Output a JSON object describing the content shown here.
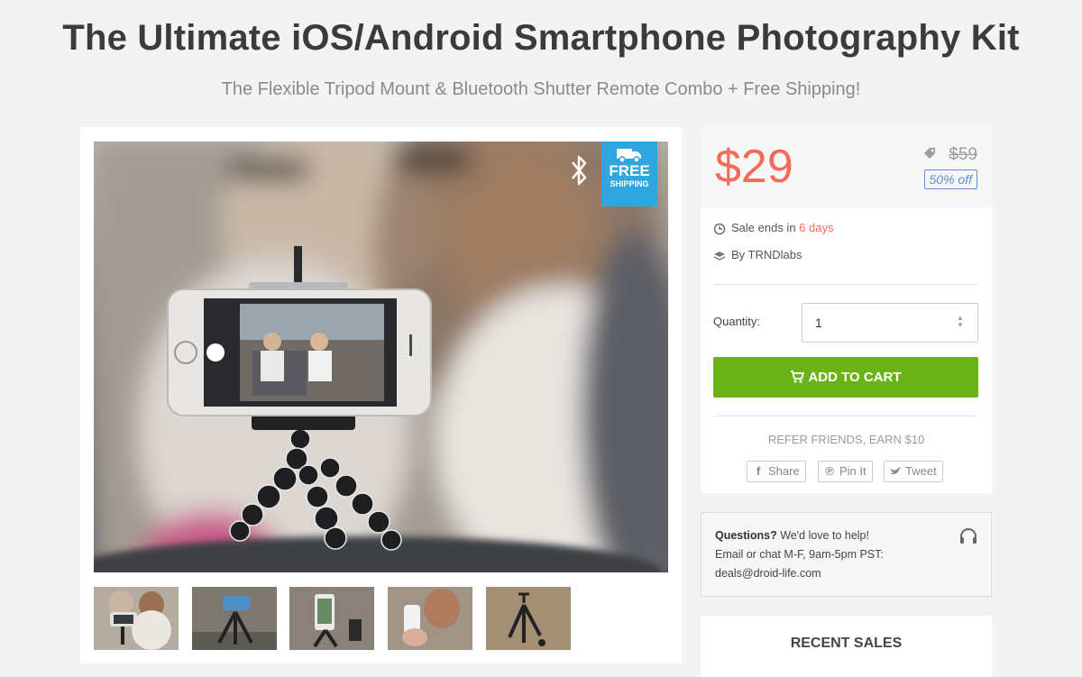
{
  "deal": {
    "title": "The Ultimate iOS/Android Smartphone Photography Kit",
    "subtitle": "The Flexible Tripod Mount & Bluetooth Shutter Remote Combo + Free Shipping!"
  },
  "gallery": {
    "badge": {
      "line1": "FREE",
      "line2": "SHIPPING"
    },
    "thumbnail_count": 5
  },
  "pricing": {
    "price": "$29",
    "original_price": "$59",
    "discount": "50% off",
    "sale_ends_prefix": "Sale ends in ",
    "sale_ends_value": "6 days",
    "vendor": "By TRNDlabs",
    "quantity_label": "Quantity:",
    "quantity_value": "1",
    "add_to_cart": "ADD TO CART",
    "refer": "REFER FRIENDS, EARN $10",
    "share": "Share",
    "pin": "Pin It",
    "tweet": "Tweet"
  },
  "help": {
    "question": "Questions?",
    "line1_rest": " We'd love to help!",
    "line2": "Email or chat M-F, 9am-5pm PST:",
    "email": "deals@droid-life.com"
  },
  "recent_sales": {
    "title": "RECENT SALES"
  },
  "colors": {
    "price": "#f26b5b",
    "add_to_cart": "#6ab418",
    "badge": "#2da7e0",
    "discount": "#5b8fd6"
  }
}
